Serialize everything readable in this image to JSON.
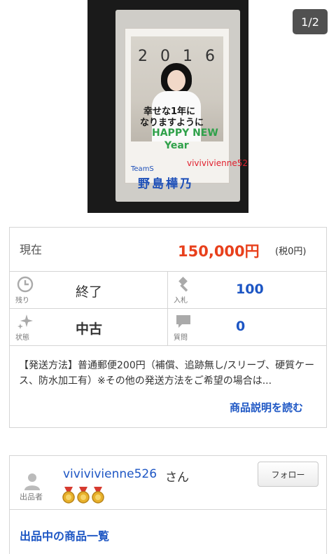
{
  "gallery": {
    "counter": "1/2",
    "photo": {
      "year_text": "2016",
      "message_line1": "幸せな1年に",
      "message_line2": "なりますように",
      "greeting_line1": "HAPPY NEW",
      "greeting_line2": "Year",
      "team_text": "TeamS",
      "signature_text": "野島樺乃",
      "watermark": "vivivivienne526"
    }
  },
  "price": {
    "label": "現在",
    "value": "150,000円",
    "tax": "(税0円)"
  },
  "stats": [
    {
      "caption": "残り",
      "value": "終了",
      "icon": "clock-icon"
    },
    {
      "caption": "入札",
      "value": "100",
      "icon": "gavel-icon"
    },
    {
      "caption": "状態",
      "value": "中古",
      "icon": "sparkle-icon"
    },
    {
      "caption": "質問",
      "value": "0",
      "icon": "chat-bubble-icon"
    }
  ],
  "description": {
    "text": "【発送方法】普通郵便200円（補償、追跡無し/スリーブ、硬質ケース、防水加工有）※その他の発送方法をご希望の場合は...",
    "read_more": "商品説明を読む"
  },
  "seller": {
    "caption": "出品者",
    "name": "vivivivienne526",
    "suffix": "さん",
    "follow": "フォロー",
    "items_link": "出品中の商品一覧"
  },
  "colors": {
    "price": "#e8401c",
    "link": "#1d56c4",
    "border": "#d5d5d5"
  }
}
